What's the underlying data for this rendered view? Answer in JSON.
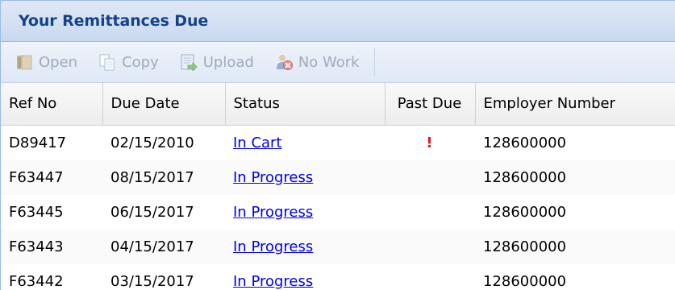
{
  "panel": {
    "title": "Your Remittances Due"
  },
  "toolbar": {
    "open_label": "Open",
    "copy_label": "Copy",
    "upload_label": "Upload",
    "nowork_label": "No Work",
    "icons": [
      "open-folder-icon",
      "copy-icon",
      "upload-icon",
      "no-work-icon"
    ],
    "disabled_color": "#a2abb6"
  },
  "grid": {
    "columns": [
      "Ref No",
      "Due Date",
      "Status",
      "Past Due",
      "Employer Number"
    ],
    "rows": [
      {
        "ref": "D89417",
        "due": "02/15/2010",
        "status": "In Cart",
        "past_due": "!",
        "employer": "128600000"
      },
      {
        "ref": "F63447",
        "due": "08/15/2017",
        "status": "In Progress",
        "past_due": "",
        "employer": "128600000"
      },
      {
        "ref": "F63445",
        "due": "06/15/2017",
        "status": "In Progress",
        "past_due": "",
        "employer": "128600000"
      },
      {
        "ref": "F63443",
        "due": "04/15/2017",
        "status": "In Progress",
        "past_due": "",
        "employer": "128600000"
      },
      {
        "ref": "F63442",
        "due": "03/15/2017",
        "status": "In Progress",
        "past_due": "",
        "employer": "128600000"
      }
    ]
  },
  "colors": {
    "title": "#15428b",
    "link": "#0000ee",
    "past_due_flag": "#e0191a"
  }
}
